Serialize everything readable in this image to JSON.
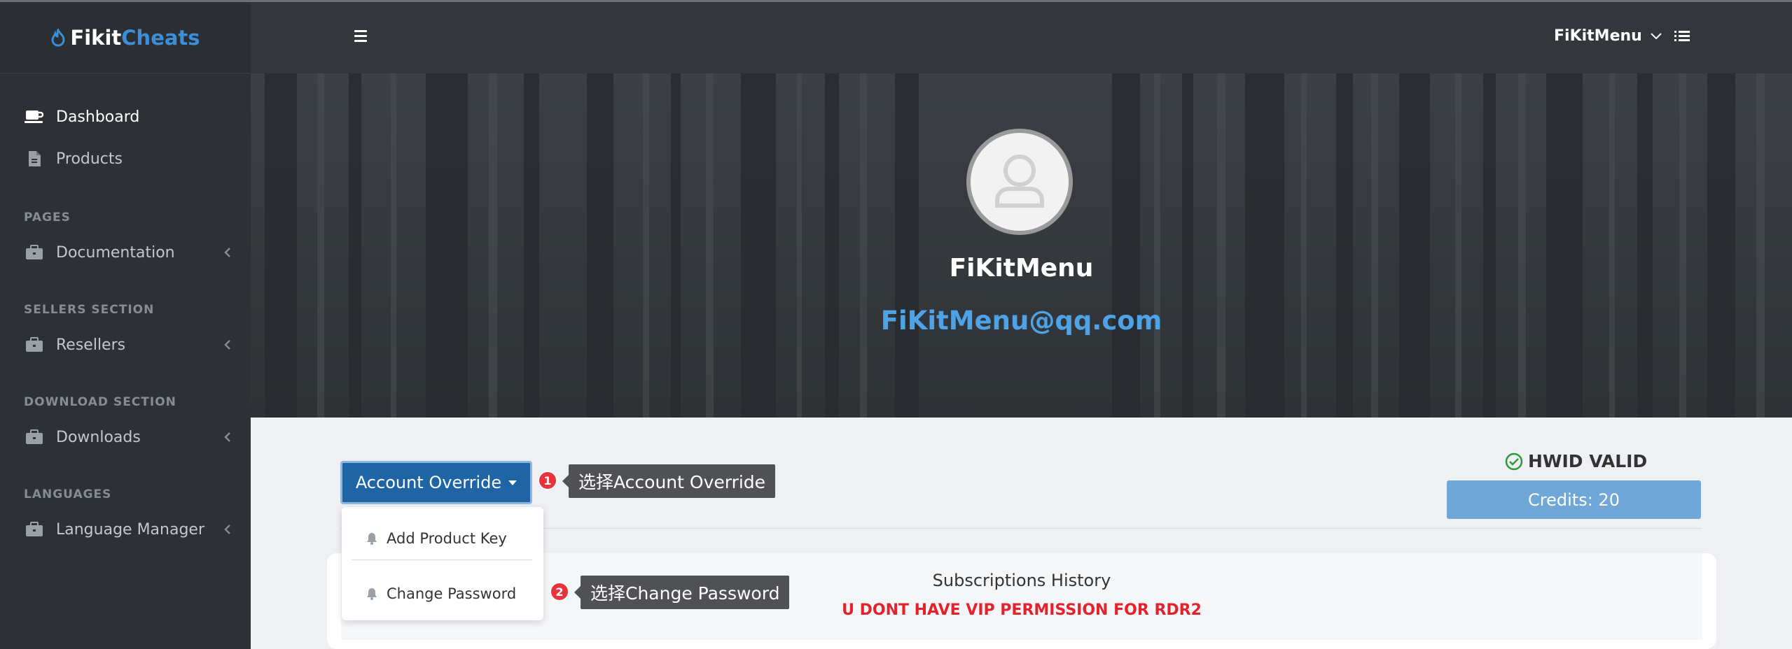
{
  "brand": {
    "part1": "Fikit",
    "part2": "Cheats"
  },
  "sidebar": {
    "items": [
      {
        "label": "Dashboard"
      },
      {
        "label": "Products"
      },
      {
        "label": "Documentation"
      },
      {
        "label": "Resellers"
      },
      {
        "label": "Downloads"
      },
      {
        "label": "Language Manager"
      }
    ],
    "headers": [
      "PAGES",
      "SELLERS SECTION",
      "DOWNLOAD SECTION",
      "LANGUAGES"
    ]
  },
  "header": {
    "username": "FiKitMenu"
  },
  "profile": {
    "name": "FiKitMenu",
    "email": "FiKitMenu@qq.com"
  },
  "account": {
    "dropdown_label": "Account Override",
    "menu_items": [
      "Add Product Key",
      "Change Password"
    ]
  },
  "annotations": [
    {
      "number": "1",
      "text": "选择Account Override"
    },
    {
      "number": "2",
      "text": "选择Change Password"
    }
  ],
  "status": {
    "hwid": "HWID VALID",
    "credits": "Credits: 20"
  },
  "subscriptions": {
    "title": "Subscriptions History",
    "warning": "U DONT HAVE VIP PERMISSION FOR RDR2"
  },
  "colors": {
    "brand_accent": "#3b8fd8",
    "button": "#1f64a5",
    "credits": "#6fa7d8",
    "warning": "#e5212b",
    "sidebar": "#2d3035"
  }
}
